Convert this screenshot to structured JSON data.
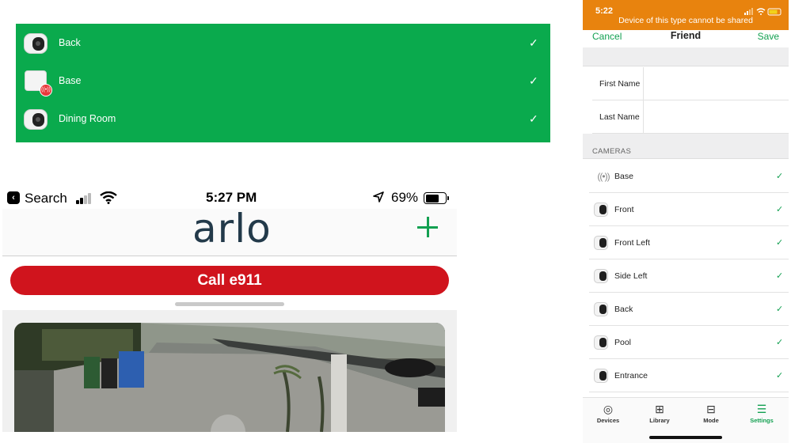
{
  "devices_panel": {
    "background": "#0aaa4d",
    "items": [
      {
        "label": "Back",
        "icon": "camera-icon",
        "selected": true
      },
      {
        "label": "Base",
        "icon": "base-station-icon",
        "selected": true
      },
      {
        "label": "Dining Room",
        "icon": "camera-icon",
        "selected": true
      }
    ],
    "check_glyph": "✓"
  },
  "arlo_screen": {
    "status_bar": {
      "back_app": "Search",
      "time": "5:27 PM",
      "battery": "69%"
    },
    "logo": "arlo",
    "call_button": "Call e911",
    "accent": "#13a051",
    "call_color": "#d0141d"
  },
  "share_screen": {
    "status_time": "5:22",
    "warning": "Device of this type cannot be shared",
    "warning_color": "#e8830e",
    "nav": {
      "cancel": "Cancel",
      "title": "Friend",
      "save": "Save"
    },
    "fields": [
      {
        "label": "First Name",
        "value": ""
      },
      {
        "label": "Last Name",
        "value": ""
      }
    ],
    "section_header": "CAMERAS",
    "cameras": [
      {
        "name": "Base",
        "icon": "base-station-icon",
        "checked": true
      },
      {
        "name": "Front",
        "icon": "camera-icon",
        "checked": true
      },
      {
        "name": "Front Left",
        "icon": "camera-icon",
        "checked": true
      },
      {
        "name": "Side Left",
        "icon": "camera-icon",
        "checked": true
      },
      {
        "name": "Back",
        "icon": "camera-icon",
        "checked": true
      },
      {
        "name": "Pool",
        "icon": "camera-icon",
        "checked": true
      },
      {
        "name": "Entrance",
        "icon": "camera-icon",
        "checked": true
      }
    ],
    "tabs": [
      {
        "label": "Devices",
        "icon": "devices-icon",
        "active": false
      },
      {
        "label": "Library",
        "icon": "library-icon",
        "active": false
      },
      {
        "label": "Mode",
        "icon": "mode-icon",
        "active": false
      },
      {
        "label": "Settings",
        "icon": "settings-icon",
        "active": true
      }
    ]
  }
}
